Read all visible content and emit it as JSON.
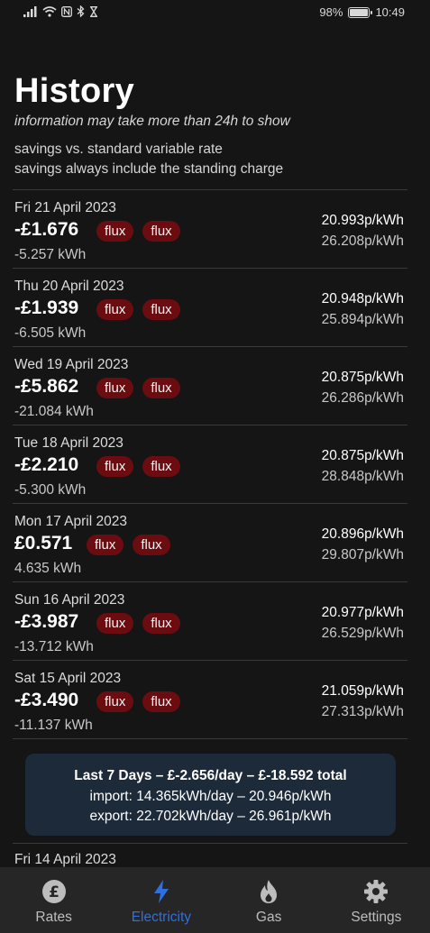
{
  "status_bar": {
    "battery_percent": "98%",
    "time": "10:49",
    "icons": [
      "signal-icon",
      "wifi-icon",
      "nfc-icon",
      "bluetooth-icon",
      "hourglass-icon"
    ]
  },
  "header": {
    "title": "History",
    "subtitle": "information may take more than 24h to show",
    "note_1": "savings vs. standard variable rate",
    "note_2": "savings always include the standing charge"
  },
  "days": [
    {
      "date": "Fri 21 April 2023",
      "amount": "-£1.676",
      "kwh": "-5.257 kWh",
      "badge_1": "flux",
      "badge_2": "flux",
      "rate_1": "20.993p/kWh",
      "rate_2": "26.208p/kWh"
    },
    {
      "date": "Thu 20 April 2023",
      "amount": "-£1.939",
      "kwh": "-6.505 kWh",
      "badge_1": "flux",
      "badge_2": "flux",
      "rate_1": "20.948p/kWh",
      "rate_2": "25.894p/kWh"
    },
    {
      "date": "Wed 19 April 2023",
      "amount": "-£5.862",
      "kwh": "-21.084 kWh",
      "badge_1": "flux",
      "badge_2": "flux",
      "rate_1": "20.875p/kWh",
      "rate_2": "26.286p/kWh"
    },
    {
      "date": "Tue 18 April 2023",
      "amount": "-£2.210",
      "kwh": "-5.300 kWh",
      "badge_1": "flux",
      "badge_2": "flux",
      "rate_1": "20.875p/kWh",
      "rate_2": "28.848p/kWh"
    },
    {
      "date": "Mon 17 April 2023",
      "amount": "£0.571",
      "kwh": "4.635 kWh",
      "badge_1": "flux",
      "badge_2": "flux",
      "rate_1": "20.896p/kWh",
      "rate_2": "29.807p/kWh"
    },
    {
      "date": "Sun 16 April 2023",
      "amount": "-£3.987",
      "kwh": "-13.712 kWh",
      "badge_1": "flux",
      "badge_2": "flux",
      "rate_1": "20.977p/kWh",
      "rate_2": "26.529p/kWh"
    },
    {
      "date": "Sat 15 April 2023",
      "amount": "-£3.490",
      "kwh": "-11.137 kWh",
      "badge_1": "flux",
      "badge_2": "flux",
      "rate_1": "21.059p/kWh",
      "rate_2": "27.313p/kWh"
    }
  ],
  "summary": {
    "title": "Last 7 Days – £-2.656/day – £-18.592 total",
    "import": "import: 14.365kWh/day – 20.946p/kWh",
    "export": "export: 22.702kWh/day – 26.961p/kWh"
  },
  "partial_date": "Fri 14 April 2023",
  "nav": {
    "rates": "Rates",
    "electricity": "Electricity",
    "gas": "Gas",
    "settings": "Settings",
    "active": "electricity",
    "active_color": "#2f6fe0"
  },
  "colors": {
    "background": "#151515",
    "badge": "#6b0d10",
    "summary_card": "#1d2a39",
    "nav_background": "#262626"
  }
}
